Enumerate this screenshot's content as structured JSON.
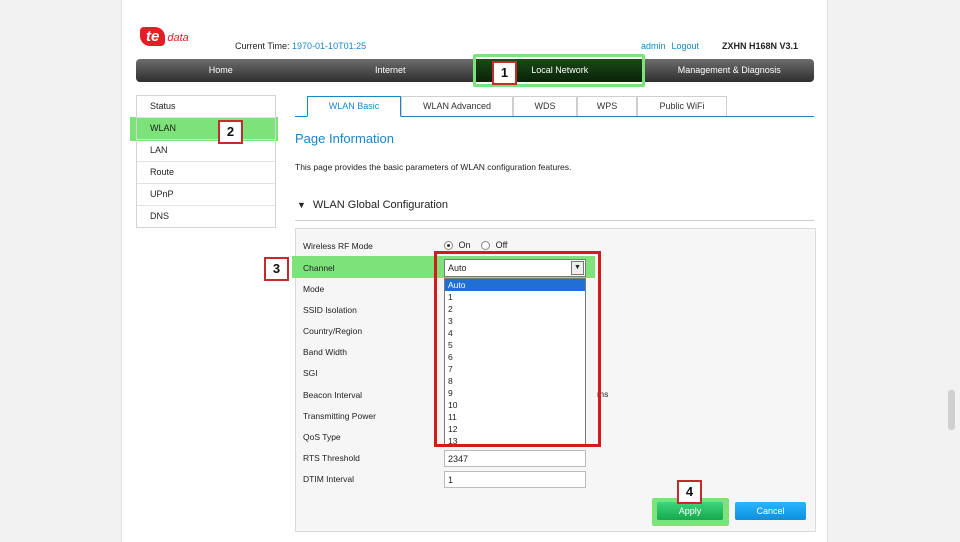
{
  "header": {
    "logo_text": "te",
    "logo_suffix": "data",
    "current_time_label": "Current Time:",
    "current_time_value": "1970-01-10T01:25",
    "user": "admin",
    "logout": "Logout",
    "model": "ZXHN H168N V3.1"
  },
  "nav": {
    "items": [
      "Home",
      "Internet",
      "Local Network",
      "Management & Diagnosis"
    ],
    "active": "Local Network"
  },
  "sidebar": {
    "items": [
      "Status",
      "WLAN",
      "LAN",
      "Route",
      "UPnP",
      "DNS"
    ],
    "active": "WLAN"
  },
  "tabs": [
    "WLAN Basic",
    "WLAN Advanced",
    "WDS",
    "WPS",
    "Public WiFi"
  ],
  "page": {
    "title": "Page Information",
    "description": "This page provides the basic parameters of WLAN configuration features.",
    "section_title": "WLAN Global Configuration"
  },
  "form": {
    "labels": {
      "rf_mode": "Wireless RF Mode",
      "channel": "Channel",
      "mode": "Mode",
      "ssid_isolation": "SSID Isolation",
      "country": "Country/Region",
      "band_width": "Band Width",
      "sgi": "SGI",
      "beacon": "Beacon Interval",
      "tx_power": "Transmitting Power",
      "qos": "QoS Type",
      "rts": "RTS Threshold",
      "dtim": "DTIM Interval"
    },
    "rf_on": "On",
    "rf_off": "Off",
    "channel_value": "Auto",
    "channel_options": [
      "Auto",
      "1",
      "2",
      "3",
      "4",
      "5",
      "6",
      "7",
      "8",
      "9",
      "10",
      "11",
      "12",
      "13"
    ],
    "beacon_unit": "ms",
    "rts_value": "2347",
    "dtim_value": "1"
  },
  "buttons": {
    "apply": "Apply",
    "cancel": "Cancel"
  },
  "annotations": {
    "n1": "1",
    "n2": "2",
    "n3": "3",
    "n4": "4"
  },
  "colors": {
    "accent": "#1a85c8",
    "highlight": "#7de27a",
    "annotation_red": "#d21b1b",
    "brand_red": "#e21f26"
  }
}
